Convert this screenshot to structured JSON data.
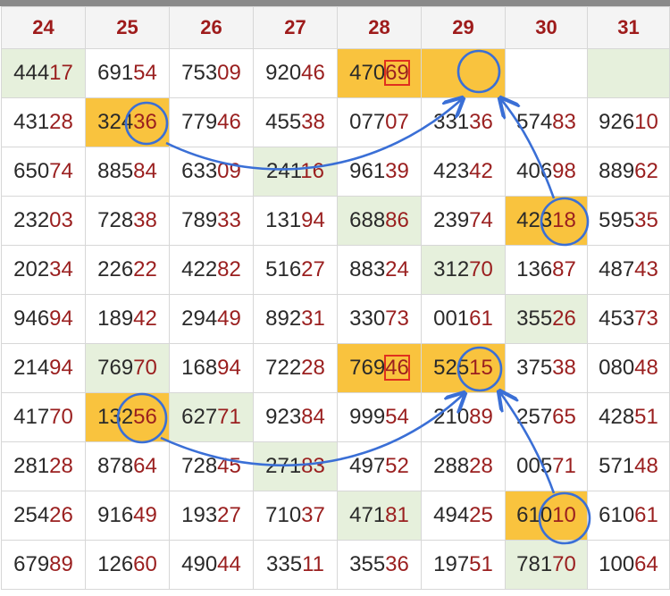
{
  "headers": [
    "24",
    "25",
    "26",
    "27",
    "28",
    "29",
    "30",
    "31"
  ],
  "rows": [
    [
      {
        "p": "444",
        "s": "17",
        "bg": "g"
      },
      {
        "p": "691",
        "s": "54"
      },
      {
        "p": "753",
        "s": "09"
      },
      {
        "p": "920",
        "s": "46"
      },
      {
        "p": "470",
        "s": "69",
        "bg": "y",
        "sq": true
      },
      {
        "p": "",
        "s": "",
        "bg": "y"
      },
      {
        "p": "",
        "s": ""
      },
      {
        "p": "",
        "s": "",
        "bg": "g"
      }
    ],
    [
      {
        "p": "431",
        "s": "28"
      },
      {
        "p": "324",
        "s": "36",
        "bg": "y"
      },
      {
        "p": "779",
        "s": "46"
      },
      {
        "p": "455",
        "s": "38"
      },
      {
        "p": "077",
        "s": "07"
      },
      {
        "p": "331",
        "s": "36"
      },
      {
        "p": "574",
        "s": "83"
      },
      {
        "p": "926",
        "s": "10"
      }
    ],
    [
      {
        "p": "650",
        "s": "74"
      },
      {
        "p": "885",
        "s": "84"
      },
      {
        "p": "633",
        "s": "09"
      },
      {
        "p": "241",
        "s": "16",
        "bg": "g"
      },
      {
        "p": "961",
        "s": "39"
      },
      {
        "p": "423",
        "s": "42"
      },
      {
        "p": "406",
        "s": "98"
      },
      {
        "p": "889",
        "s": "62"
      }
    ],
    [
      {
        "p": "232",
        "s": "03"
      },
      {
        "p": "728",
        "s": "38"
      },
      {
        "p": "789",
        "s": "33"
      },
      {
        "p": "131",
        "s": "94"
      },
      {
        "p": "688",
        "s": "86",
        "bg": "g"
      },
      {
        "p": "239",
        "s": "74"
      },
      {
        "p": "423",
        "s": "18",
        "bg": "y"
      },
      {
        "p": "595",
        "s": "35"
      }
    ],
    [
      {
        "p": "202",
        "s": "34"
      },
      {
        "p": "226",
        "s": "22"
      },
      {
        "p": "422",
        "s": "82"
      },
      {
        "p": "516",
        "s": "27"
      },
      {
        "p": "883",
        "s": "24"
      },
      {
        "p": "312",
        "s": "70",
        "bg": "g"
      },
      {
        "p": "136",
        "s": "87"
      },
      {
        "p": "487",
        "s": "43"
      }
    ],
    [
      {
        "p": "946",
        "s": "94"
      },
      {
        "p": "189",
        "s": "42"
      },
      {
        "p": "294",
        "s": "49"
      },
      {
        "p": "892",
        "s": "31"
      },
      {
        "p": "330",
        "s": "73"
      },
      {
        "p": "001",
        "s": "61"
      },
      {
        "p": "355",
        "s": "26",
        "bg": "g"
      },
      {
        "p": "453",
        "s": "73"
      }
    ],
    [
      {
        "p": "214",
        "s": "94"
      },
      {
        "p": "769",
        "s": "70",
        "bg": "g"
      },
      {
        "p": "168",
        "s": "94"
      },
      {
        "p": "722",
        "s": "28"
      },
      {
        "p": "769",
        "s": "46",
        "bg": "y",
        "sq": true
      },
      {
        "p": "525",
        "s": "15",
        "bg": "y"
      },
      {
        "p": "375",
        "s": "38"
      },
      {
        "p": "080",
        "s": "48"
      }
    ],
    [
      {
        "p": "417",
        "s": "70"
      },
      {
        "p": "132",
        "s": "56",
        "bg": "y"
      },
      {
        "p": "627",
        "s": "71",
        "bg": "g"
      },
      {
        "p": "923",
        "s": "84"
      },
      {
        "p": "999",
        "s": "54"
      },
      {
        "p": "210",
        "s": "89"
      },
      {
        "p": "257",
        "s": "65"
      },
      {
        "p": "428",
        "s": "51"
      }
    ],
    [
      {
        "p": "281",
        "s": "28"
      },
      {
        "p": "878",
        "s": "64"
      },
      {
        "p": "728",
        "s": "45"
      },
      {
        "p": "271",
        "s": "83",
        "bg": "g"
      },
      {
        "p": "497",
        "s": "52"
      },
      {
        "p": "288",
        "s": "28"
      },
      {
        "p": "005",
        "s": "71"
      },
      {
        "p": "571",
        "s": "48"
      }
    ],
    [
      {
        "p": "254",
        "s": "26"
      },
      {
        "p": "916",
        "s": "49"
      },
      {
        "p": "193",
        "s": "27"
      },
      {
        "p": "710",
        "s": "37"
      },
      {
        "p": "471",
        "s": "81",
        "bg": "g"
      },
      {
        "p": "494",
        "s": "25"
      },
      {
        "p": "610",
        "s": "10",
        "bg": "y"
      },
      {
        "p": "610",
        "s": "61"
      }
    ],
    [
      {
        "p": "679",
        "s": "89"
      },
      {
        "p": "126",
        "s": "60"
      },
      {
        "p": "490",
        "s": "44"
      },
      {
        "p": "335",
        "s": "11"
      },
      {
        "p": "355",
        "s": "36"
      },
      {
        "p": "197",
        "s": "51"
      },
      {
        "p": "781",
        "s": "70",
        "bg": "g"
      },
      {
        "p": "100",
        "s": "64"
      }
    ]
  ],
  "colors": {
    "header_text": "#9e1b1b",
    "suffix_text": "#9a1f1f",
    "highlight_yellow": "#f9c33e",
    "highlight_green": "#e6f0dc",
    "annotation_blue": "#3a6fd6",
    "box_red": "#e0301e"
  }
}
